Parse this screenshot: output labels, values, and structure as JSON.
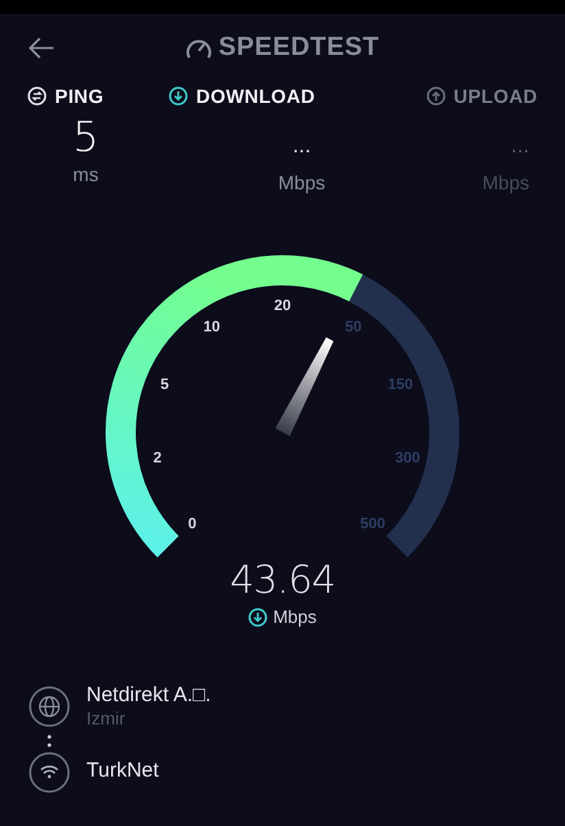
{
  "header": {
    "title": "SPEEDTEST"
  },
  "tabs": [
    {
      "label": "PING",
      "kind": "ping",
      "selected": false,
      "disabled": false,
      "value": "5",
      "unit": "ms"
    },
    {
      "label": "DOWNLOAD",
      "kind": "download",
      "selected": true,
      "disabled": false,
      "value": "...",
      "unit": "Mbps"
    },
    {
      "label": "UPLOAD",
      "kind": "upload",
      "selected": false,
      "disabled": true,
      "value": "...",
      "unit": "Mbps"
    }
  ],
  "gauge": {
    "ticks": [
      "0",
      "2",
      "5",
      "10",
      "20",
      "50",
      "150",
      "300",
      "500"
    ],
    "speed": "43.64",
    "unit": "Mbps"
  },
  "connection": {
    "provider": "Netdirekt A.□.",
    "location": "Izmir",
    "network": "TurkNet"
  }
}
